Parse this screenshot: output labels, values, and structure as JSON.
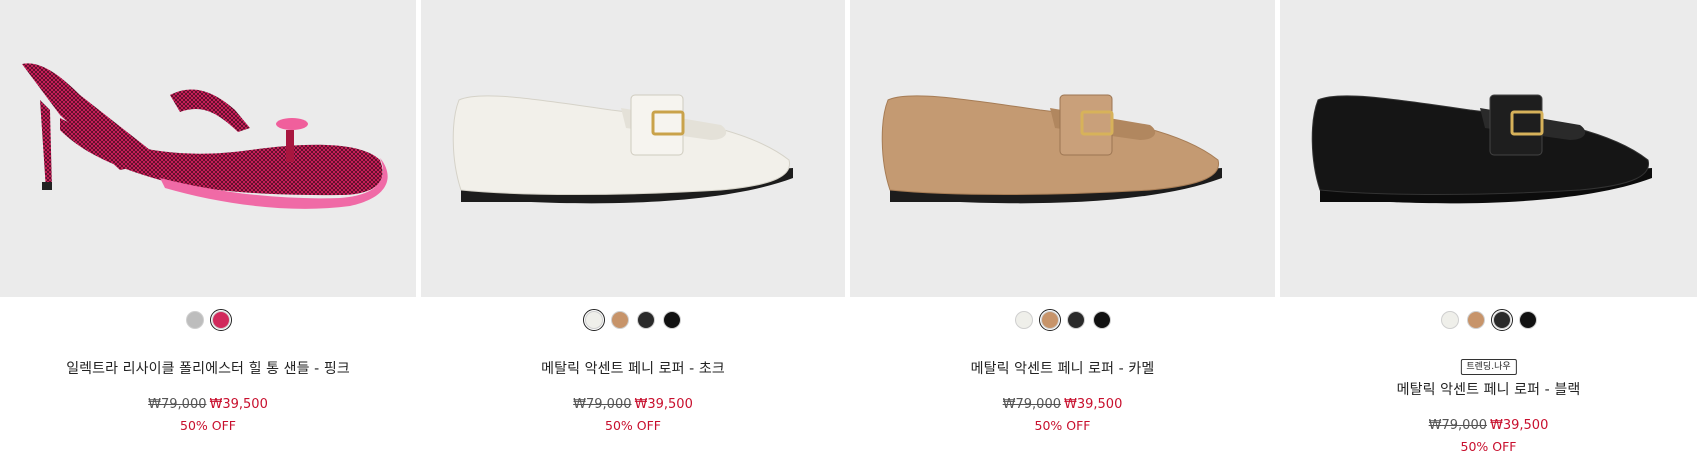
{
  "products": [
    {
      "name": "일렉트라 리사이클 폴리에스터 힐 통 샌들 - 핑크",
      "badge": "",
      "original_price": "₩79,000",
      "sale_price": "₩39,500",
      "discount": "50% OFF",
      "shoe_color": "#d9205f",
      "swatches": [
        {
          "color": "#bdbdbd",
          "selected": false
        },
        {
          "color": "#d12a5c",
          "selected": true
        }
      ]
    },
    {
      "name": "메탈릭 악센트 페니 로퍼 - 초크",
      "badge": "",
      "original_price": "₩79,000",
      "sale_price": "₩39,500",
      "discount": "50% OFF",
      "shoe_color": "#f2f0ea",
      "swatches": [
        {
          "color": "#efefea",
          "selected": true
        },
        {
          "color": "#c7946a",
          "selected": false
        },
        {
          "color": "#2a2a2a",
          "selected": false
        },
        {
          "color": "#111111",
          "selected": false
        }
      ]
    },
    {
      "name": "메탈릭 악센트 페니 로퍼 - 카멜",
      "badge": "",
      "original_price": "₩79,000",
      "sale_price": "₩39,500",
      "discount": "50% OFF",
      "shoe_color": "#c49a72",
      "swatches": [
        {
          "color": "#efefea",
          "selected": false
        },
        {
          "color": "#c7946a",
          "selected": true
        },
        {
          "color": "#2a2a2a",
          "selected": false
        },
        {
          "color": "#111111",
          "selected": false
        }
      ]
    },
    {
      "name": "메탈릭 악센트 페니 로퍼 - 블랙",
      "badge": "트렌딩.나우",
      "original_price": "₩79,000",
      "sale_price": "₩39,500",
      "discount": "50% OFF",
      "shoe_color": "#151515",
      "swatches": [
        {
          "color": "#efefea",
          "selected": false
        },
        {
          "color": "#c7946a",
          "selected": false
        },
        {
          "color": "#2a2a2a",
          "selected": true
        },
        {
          "color": "#111111",
          "selected": false
        }
      ]
    }
  ],
  "theme": {
    "sale_color": "#c8102e",
    "image_bg": "#ebebeb"
  }
}
